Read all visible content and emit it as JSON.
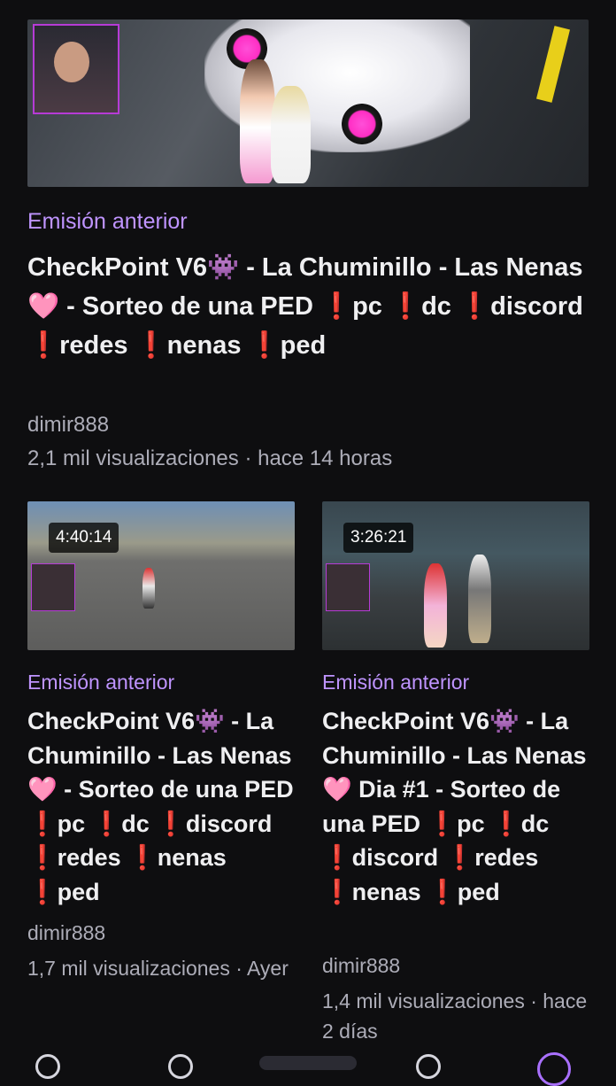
{
  "featured": {
    "label": "Emisión anterior",
    "title": "CheckPoint V6👾 - La Chuminillo - Las Nenas 🩷 - Sorteo de una PED ❗pc ❗dc ❗discord ❗redes ❗nenas ❗ped",
    "channel": "dimir888",
    "views": "2,1 mil visualizaciones · hace 14 horas"
  },
  "cards": [
    {
      "duration": "4:40:14",
      "label": "Emisión anterior",
      "title": "CheckPoint V6👾 - La Chuminillo - Las Nenas 🩷 - Sorteo de una PED ❗pc ❗dc ❗discord ❗redes ❗nenas ❗ped",
      "channel": "dimir888",
      "views": "1,7 mil visualizaciones · Ayer"
    },
    {
      "duration": "3:26:21",
      "label": "Emisión anterior",
      "title": "CheckPoint V6👾 - La Chuminillo - Las Nenas🩷 Dia #1 - Sorteo de una PED ❗pc ❗dc ❗discord ❗redes ❗nenas ❗ped",
      "channel": "dimir888",
      "views": "1,4 mil visualizaciones · hace 2 días"
    }
  ],
  "colors": {
    "background": "#0e0e10",
    "label": "#bf94ff",
    "accent": "#a970ff",
    "text": "#efeff1",
    "meta": "#adadb8"
  },
  "icons": {
    "nav": [
      "home-icon",
      "search-icon",
      "following-icon",
      "browse-icon",
      "profile-icon"
    ]
  }
}
